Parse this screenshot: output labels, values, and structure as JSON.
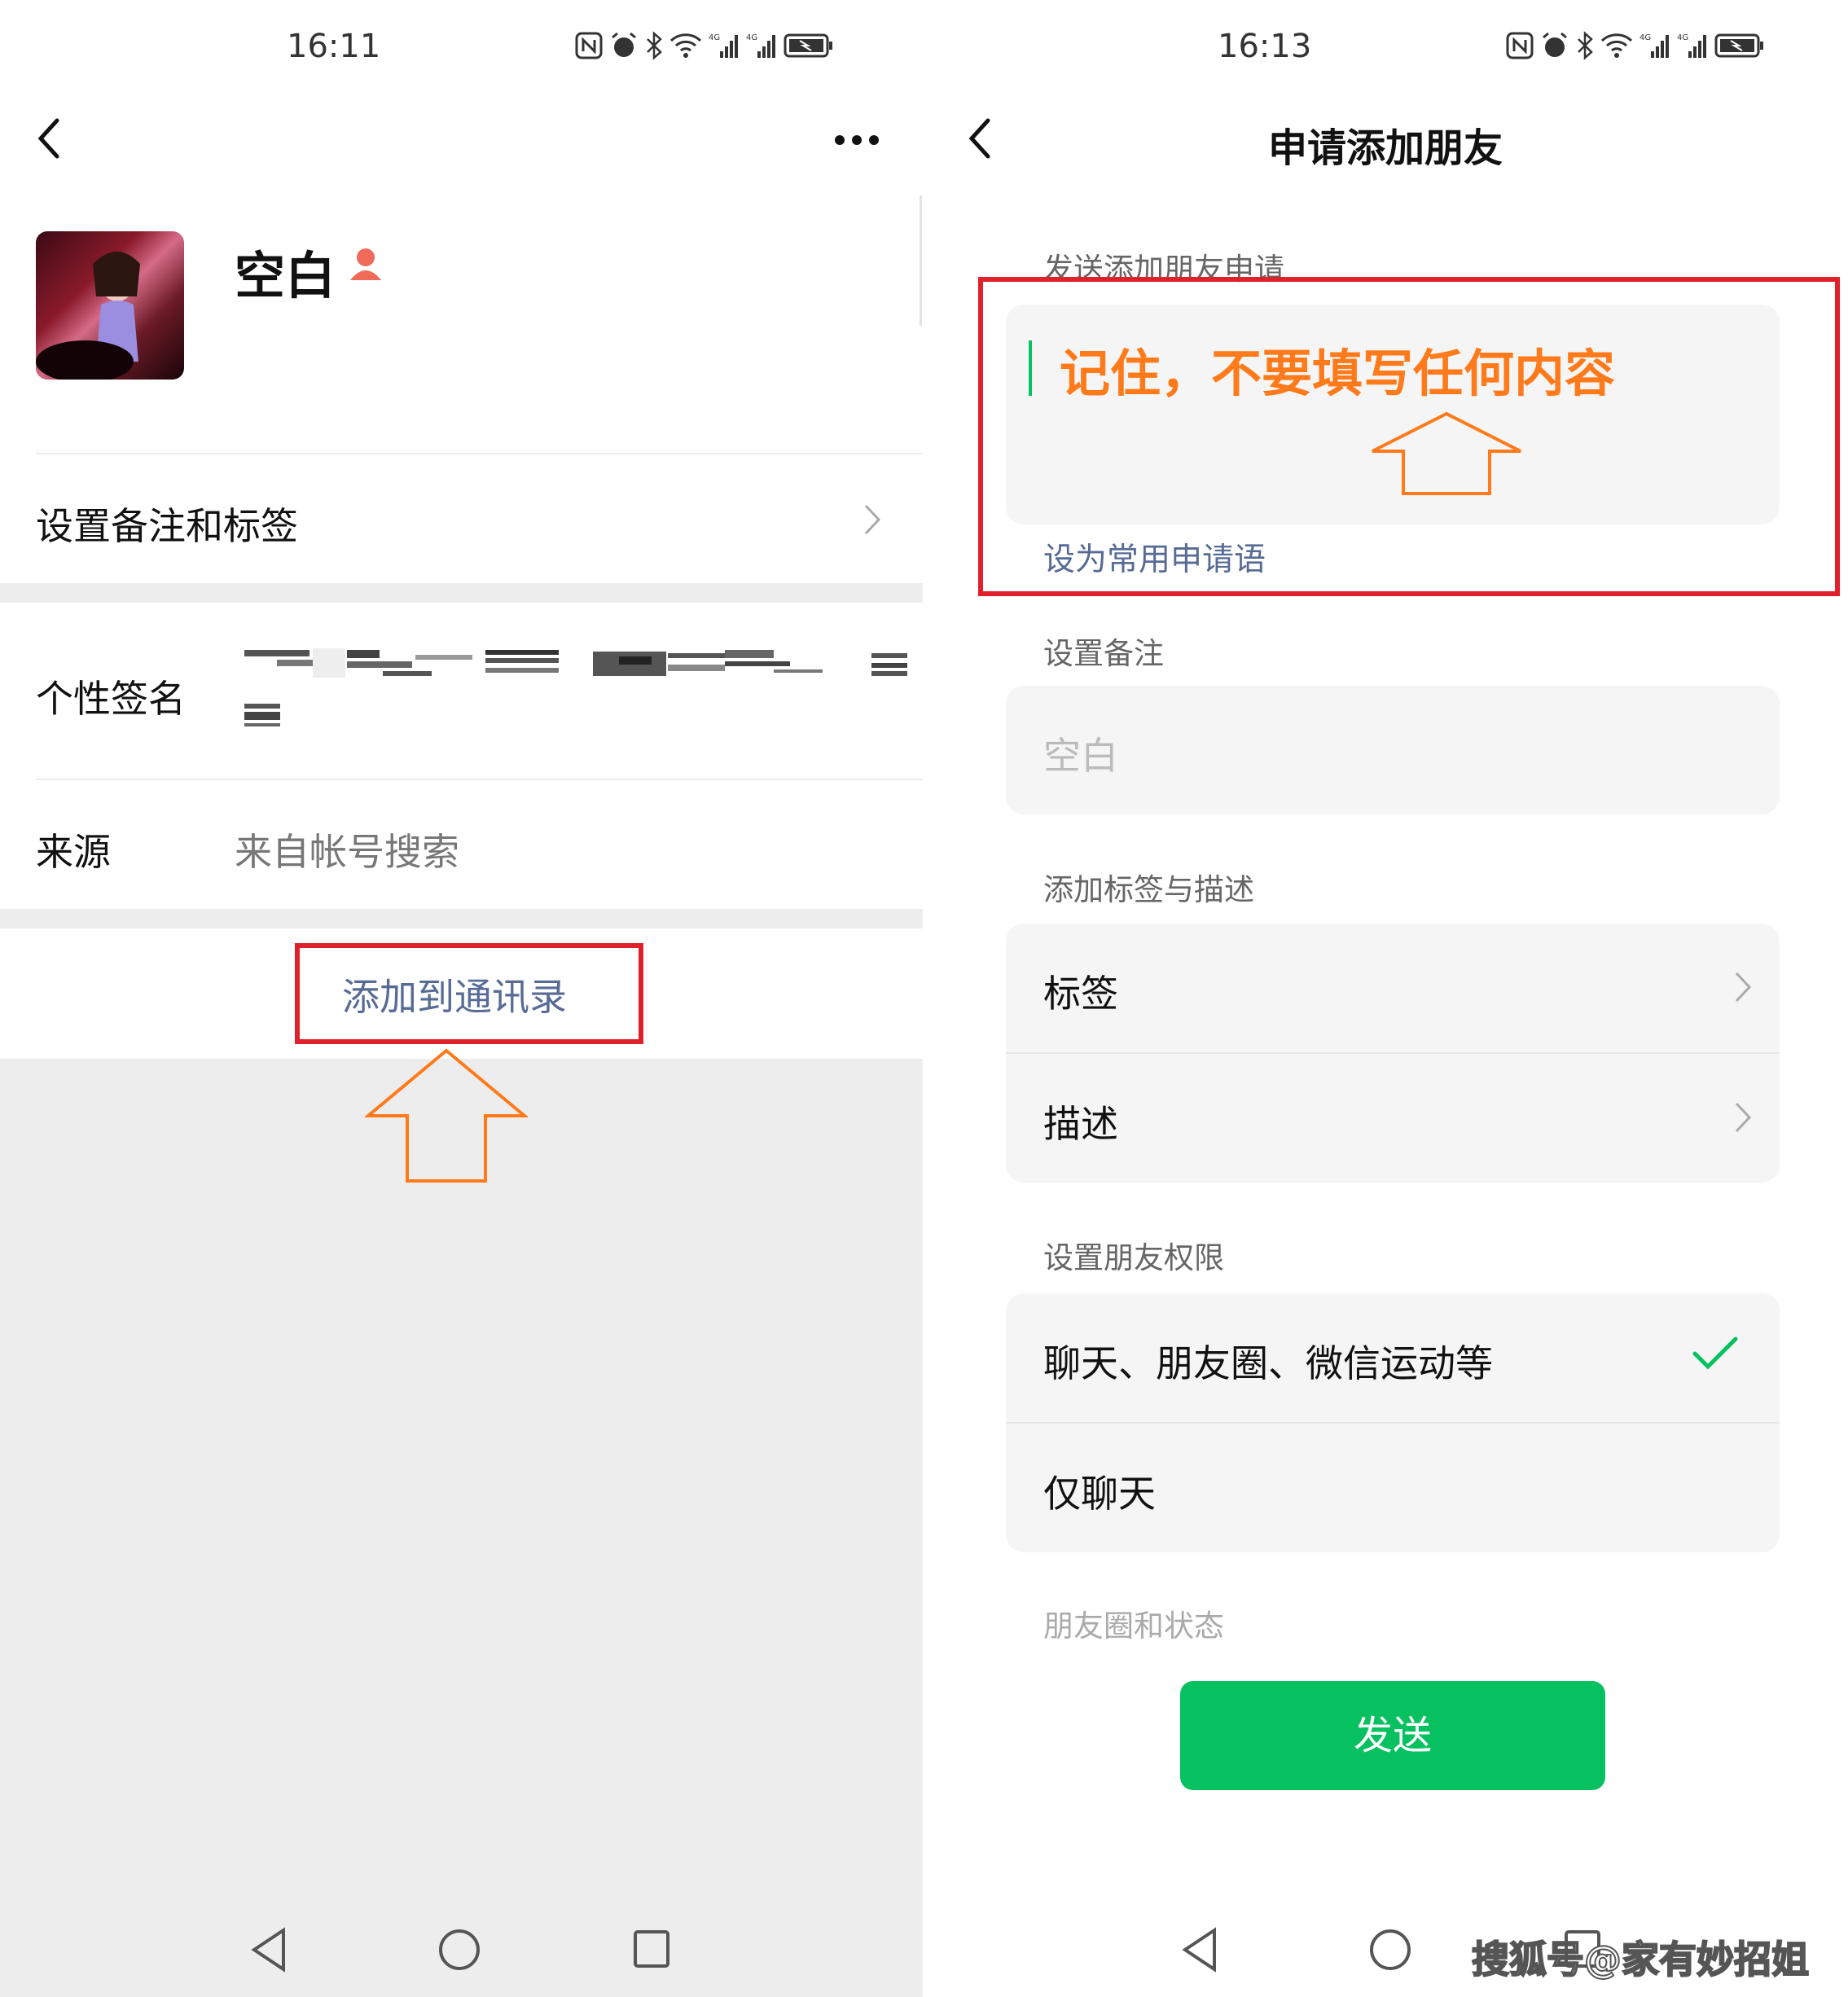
{
  "left": {
    "status": {
      "time": "16:11"
    },
    "profile": {
      "name": "空白"
    },
    "rows": {
      "remark_tags": "设置备注和标签",
      "signature_label": "个性签名",
      "source_label": "来源",
      "source_value": "来自帐号搜索"
    },
    "action": {
      "add_contact": "添加到通讯录"
    }
  },
  "right": {
    "status": {
      "time": "16:13"
    },
    "header": {
      "title": "申请添加朋友"
    },
    "request": {
      "section_label": "发送添加朋友申请",
      "annotation": "记住，不要填写任何内容",
      "set_common": "设为常用申请语"
    },
    "remark": {
      "section_label": "设置备注",
      "placeholder": "空白"
    },
    "tags": {
      "section_label": "添加标签与描述",
      "tag_label": "标签",
      "desc_label": "描述"
    },
    "permissions": {
      "section_label": "设置朋友权限",
      "opt_all": "聊天、朋友圈、微信运动等",
      "opt_chat_only": "仅聊天",
      "moments_label": "朋友圈和状态"
    },
    "send_button": "发送",
    "watermark": "搜狐号@家有妙招姐"
  },
  "colors": {
    "accent_green": "#07c160",
    "link_blue": "#576b95",
    "annotation_orange": "#ff7a1a",
    "highlight_red": "#e0202a",
    "background_grey": "#ededed"
  }
}
